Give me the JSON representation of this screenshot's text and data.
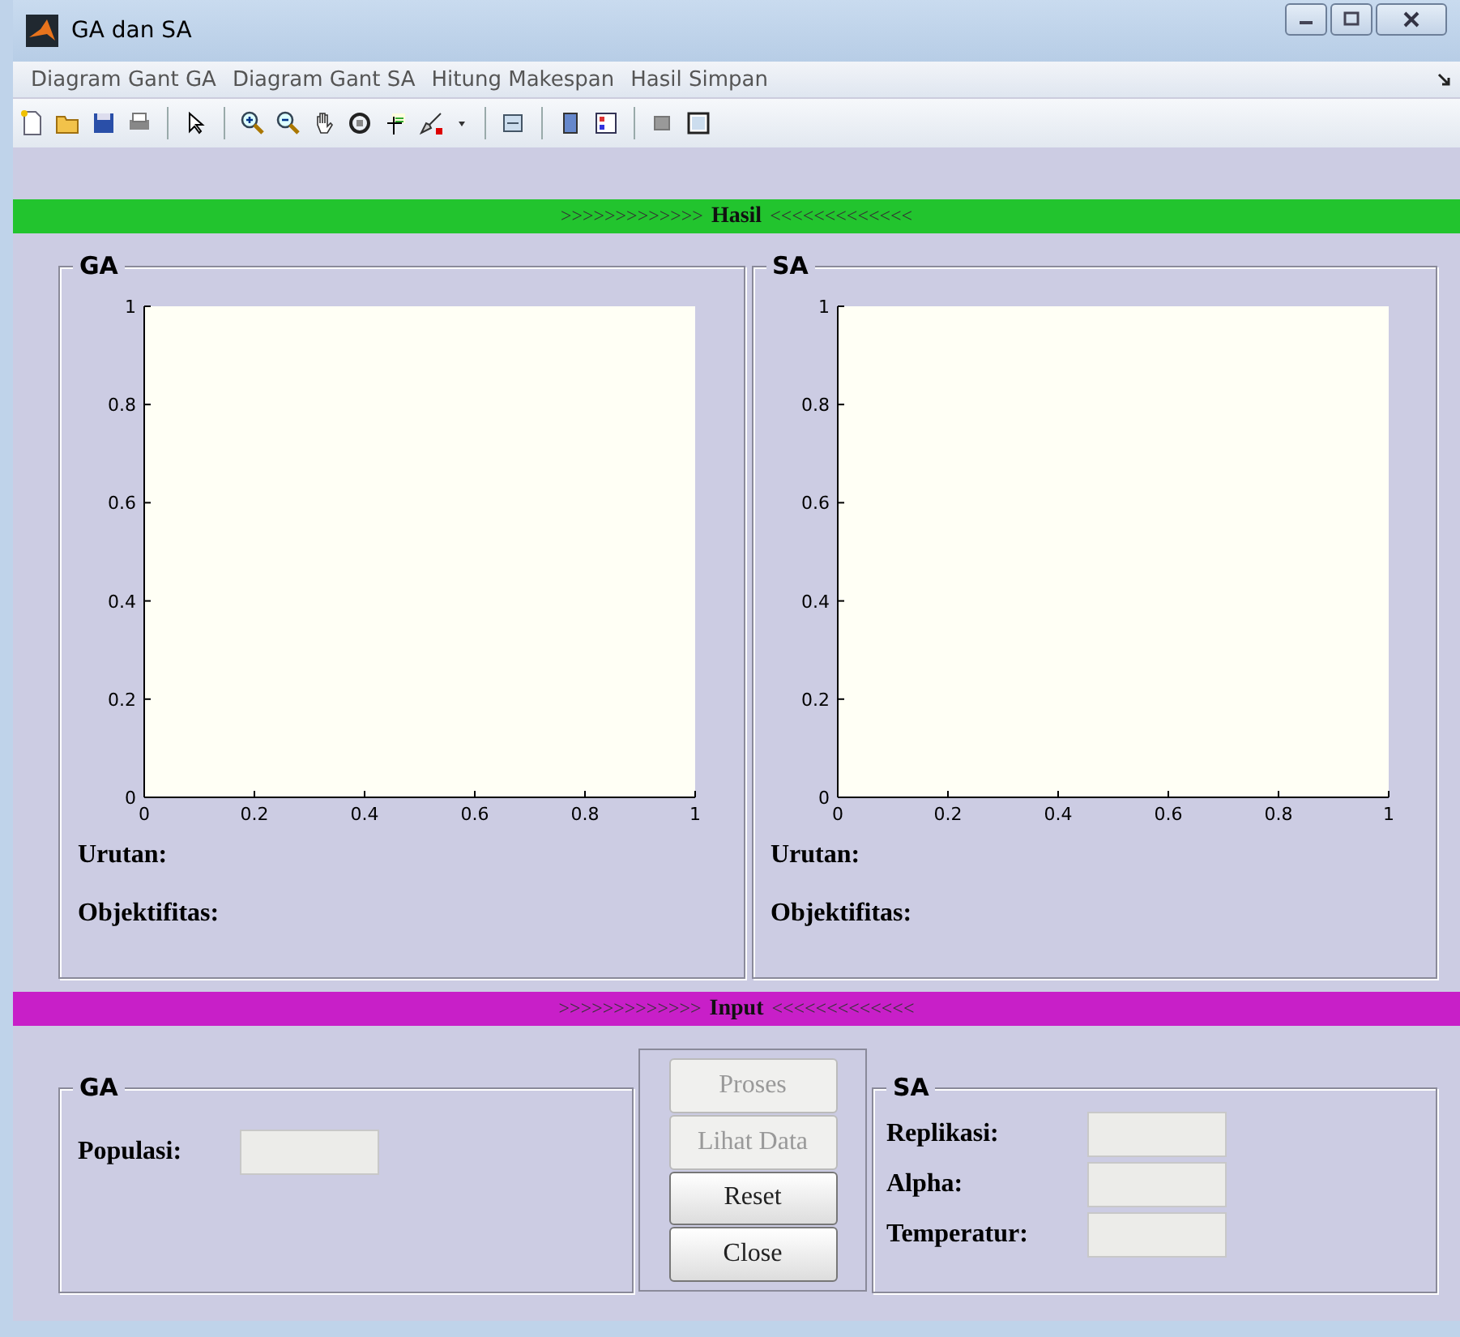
{
  "window": {
    "title": "GA dan SA"
  },
  "menu": [
    {
      "label": "Diagram Gant GA"
    },
    {
      "label": "Diagram Gant SA"
    },
    {
      "label": "Hitung Makespan"
    },
    {
      "label": "Hasil Simpan"
    }
  ],
  "hasil_banner": {
    "left": ">>>>>>>>>>>>>",
    "label": "Hasil",
    "right": "<<<<<<<<<<<<<"
  },
  "hasil_panels": [
    {
      "title": "GA",
      "chart_data": {
        "type": "line",
        "xlim": [
          0,
          1
        ],
        "ylim": [
          0,
          1
        ],
        "xticks": [
          0,
          0.2,
          0.4,
          0.6,
          0.8,
          1
        ],
        "yticks": [
          0,
          0.2,
          0.4,
          0.6,
          0.8,
          1
        ]
      },
      "fields": [
        {
          "label": "Urutan:"
        },
        {
          "label": "Objektifitas:"
        }
      ]
    },
    {
      "title": "SA",
      "chart_data": {
        "type": "line",
        "xlim": [
          0,
          1
        ],
        "ylim": [
          0,
          1
        ],
        "xticks": [
          0,
          0.2,
          0.4,
          0.6,
          0.8,
          1
        ],
        "yticks": [
          0,
          0.2,
          0.4,
          0.6,
          0.8,
          1
        ]
      },
      "fields": [
        {
          "label": "Urutan:"
        },
        {
          "label": "Objektifitas:"
        }
      ]
    }
  ],
  "input_banner": {
    "left": ">>>>>>>>>>>>>",
    "label": "Input",
    "right": "<<<<<<<<<<<<<"
  },
  "input_ga": {
    "title": "GA",
    "fields": [
      {
        "label": "Populasi:"
      }
    ]
  },
  "buttons": [
    {
      "label": "Proses",
      "disabled": true
    },
    {
      "label": "Lihat Data",
      "disabled": true
    },
    {
      "label": "Reset",
      "disabled": false
    },
    {
      "label": "Close",
      "disabled": false
    }
  ],
  "input_sa": {
    "title": "SA",
    "fields": [
      {
        "label": "Replikasi:"
      },
      {
        "label": "Alpha:"
      },
      {
        "label": "Temperatur:"
      }
    ]
  }
}
